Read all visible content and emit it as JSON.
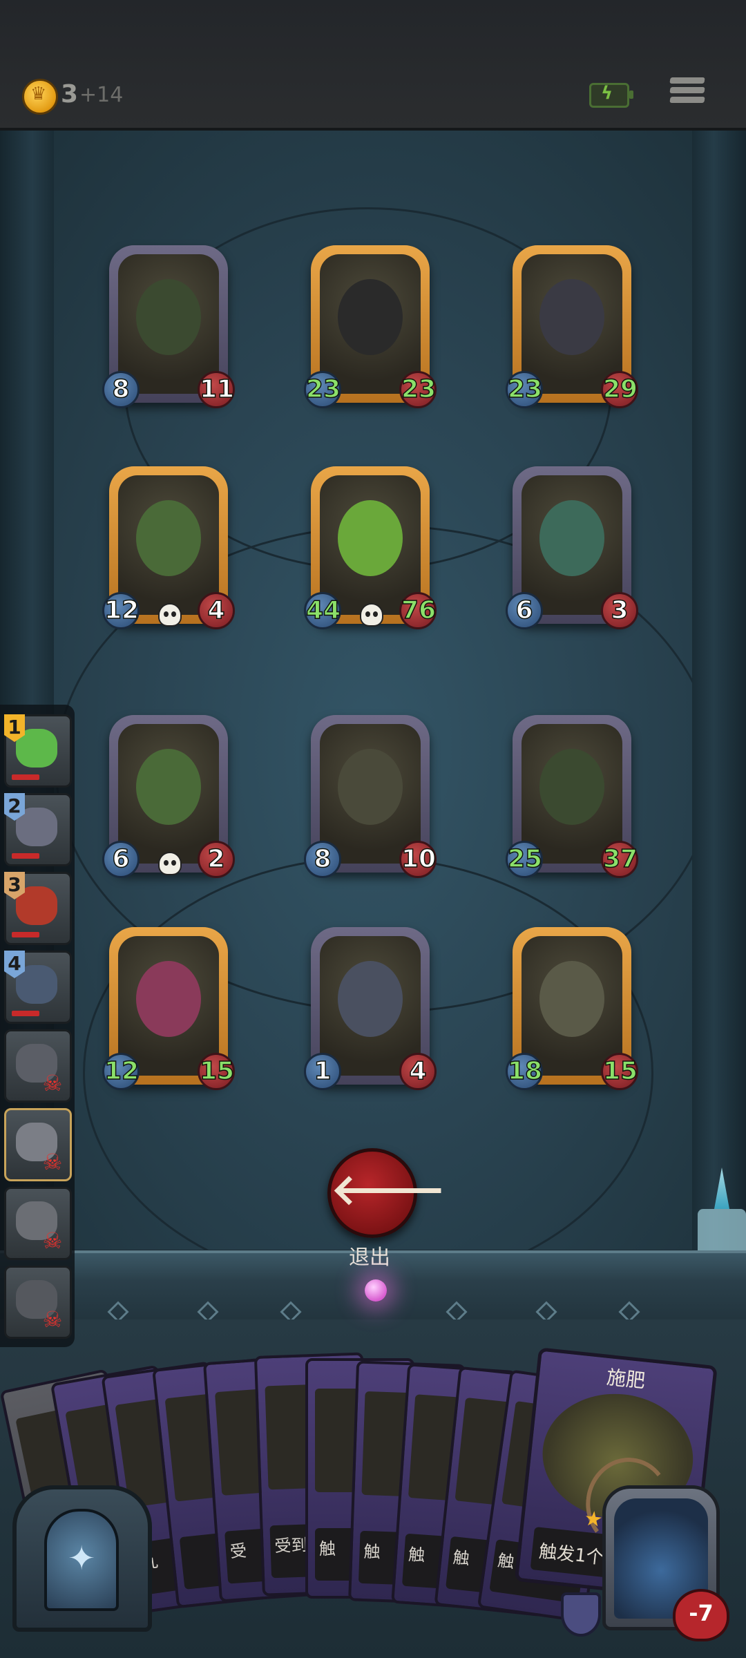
{
  "topbar": {
    "gold": "3",
    "gold_bonus": "+14",
    "icons": [
      "gold-coin-icon",
      "battery-charging-icon",
      "menu-icon"
    ]
  },
  "board": {
    "cards": [
      {
        "name": "green-horned-demon",
        "frame": "silver",
        "atk": "8",
        "hp": "11",
        "atk_buff": false,
        "hp_buff": false,
        "skull": false
      },
      {
        "name": "black-panther",
        "frame": "gold",
        "atk": "23",
        "hp": "23",
        "atk_buff": true,
        "hp_buff": true,
        "skull": false
      },
      {
        "name": "dark-horse",
        "frame": "gold",
        "atk": "23",
        "hp": "29",
        "atk_buff": true,
        "hp_buff": true,
        "skull": false
      },
      {
        "name": "flower-hat-witch",
        "frame": "gold",
        "atk": "12",
        "hp": "4",
        "atk_buff": false,
        "hp_buff": false,
        "skull": true
      },
      {
        "name": "leaf-sprite",
        "frame": "gold",
        "atk": "44",
        "hp": "76",
        "atk_buff": true,
        "hp_buff": true,
        "skull": true
      },
      {
        "name": "green-vulture",
        "frame": "silver",
        "atk": "6",
        "hp": "3",
        "atk_buff": false,
        "hp_buff": false,
        "skull": false
      },
      {
        "name": "flower-hat-witch",
        "frame": "silver",
        "atk": "6",
        "hp": "2",
        "atk_buff": false,
        "hp_buff": false,
        "skull": true
      },
      {
        "name": "hooded-wizard",
        "frame": "silver",
        "atk": "8",
        "hp": "10",
        "atk_buff": false,
        "hp_buff": false,
        "skull": false
      },
      {
        "name": "green-horned-demon",
        "frame": "silver",
        "atk": "25",
        "hp": "37",
        "atk_buff": true,
        "hp_buff": true,
        "skull": false
      },
      {
        "name": "jester-clown",
        "frame": "gold",
        "atk": "12",
        "hp": "15",
        "atk_buff": true,
        "hp_buff": true,
        "skull": false
      },
      {
        "name": "rat-bandit",
        "frame": "silver",
        "atk": "1",
        "hp": "4",
        "atk_buff": false,
        "hp_buff": false,
        "skull": false
      },
      {
        "name": "mushroom-spider",
        "frame": "gold",
        "atk": "18",
        "hp": "15",
        "atk_buff": true,
        "hp_buff": true,
        "skull": false
      }
    ]
  },
  "queue": {
    "items": [
      {
        "num": "1",
        "num_color": "#f3b42a",
        "face": "#5db84a",
        "dead": false
      },
      {
        "num": "2",
        "num_color": "#7aa6d8",
        "face": "#6b6e80",
        "dead": false
      },
      {
        "num": "3",
        "num_color": "#d8a56a",
        "face": "#b23a2a",
        "dead": false
      },
      {
        "num": "4",
        "num_color": "#7aa6d8",
        "face": "#4a5a72",
        "dead": false
      },
      {
        "num": "",
        "num_color": "",
        "face": "#5b5e66",
        "dead": true
      },
      {
        "num": "",
        "num_color": "",
        "face": "#7b7e86",
        "dead": true
      },
      {
        "num": "",
        "num_color": "",
        "face": "#6b6e74",
        "dead": true
      },
      {
        "num": "",
        "num_color": "",
        "face": "#55585e",
        "dead": true
      }
    ]
  },
  "exit": {
    "label": "退出",
    "icon": "back-arrow-icon"
  },
  "hand": {
    "cards": [
      {
        "text": "",
        "style": "first"
      },
      {
        "text": "",
        "style": ""
      },
      {
        "text": "九",
        "style": ""
      },
      {
        "text": "",
        "style": ""
      },
      {
        "text": "受",
        "style": ""
      },
      {
        "text": "受到获得",
        "style": ""
      },
      {
        "text": "触",
        "style": ""
      },
      {
        "text": "触",
        "style": ""
      },
      {
        "text": "触",
        "style": ""
      },
      {
        "text": "触",
        "style": ""
      },
      {
        "text": "触",
        "style": ""
      }
    ],
    "big_card": {
      "title": "施肥",
      "text": "触发1个"
    }
  },
  "hero": {
    "hp": "-7",
    "icons": [
      "deck-icon",
      "shield-icon",
      "heart-icon"
    ]
  }
}
